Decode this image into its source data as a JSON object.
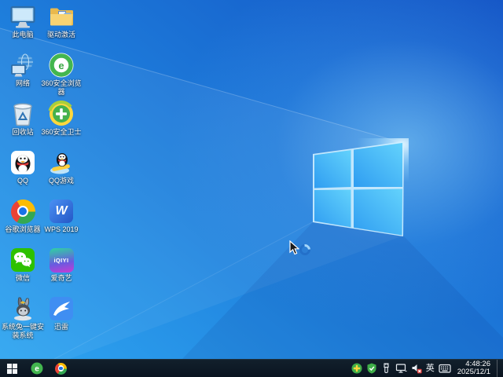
{
  "desktop": {
    "icons": [
      {
        "name": "this-pc",
        "label": "此电脑"
      },
      {
        "name": "driver-activation",
        "label": "驱动激活"
      },
      {
        "name": "network",
        "label": "网络"
      },
      {
        "name": "360-safe-browser",
        "label": "360安全浏览器",
        "icon_text": "e"
      },
      {
        "name": "recycle-bin",
        "label": "回收站"
      },
      {
        "name": "360-safety-guard",
        "label": "360安全卫士"
      },
      {
        "name": "qq",
        "label": "QQ"
      },
      {
        "name": "qq-games",
        "label": "QQ游戏"
      },
      {
        "name": "chrome",
        "label": "谷歌浏览器"
      },
      {
        "name": "wps-2019",
        "label": "WPS 2019",
        "icon_text": "W"
      },
      {
        "name": "wechat",
        "label": "微信"
      },
      {
        "name": "iqiyi",
        "label": "爱奇艺",
        "icon_text": "iQIYI"
      },
      {
        "name": "system-rabbit-installer",
        "label": "系统兔一键安装系统"
      },
      {
        "name": "xunlei-thunder",
        "label": "迅雷"
      }
    ]
  },
  "taskbar": {
    "pinned": [
      {
        "name": "360-safe-browser",
        "icon_text": "e"
      },
      {
        "name": "chrome"
      }
    ],
    "tray": {
      "language_indicator": "英",
      "time": "4:48:26",
      "date": "2025/12/1"
    }
  },
  "wallpaper": {
    "accent_blue": "#1a73e8",
    "pane_blue": "#3cb2f7"
  },
  "cursor": {
    "state": "busy"
  }
}
